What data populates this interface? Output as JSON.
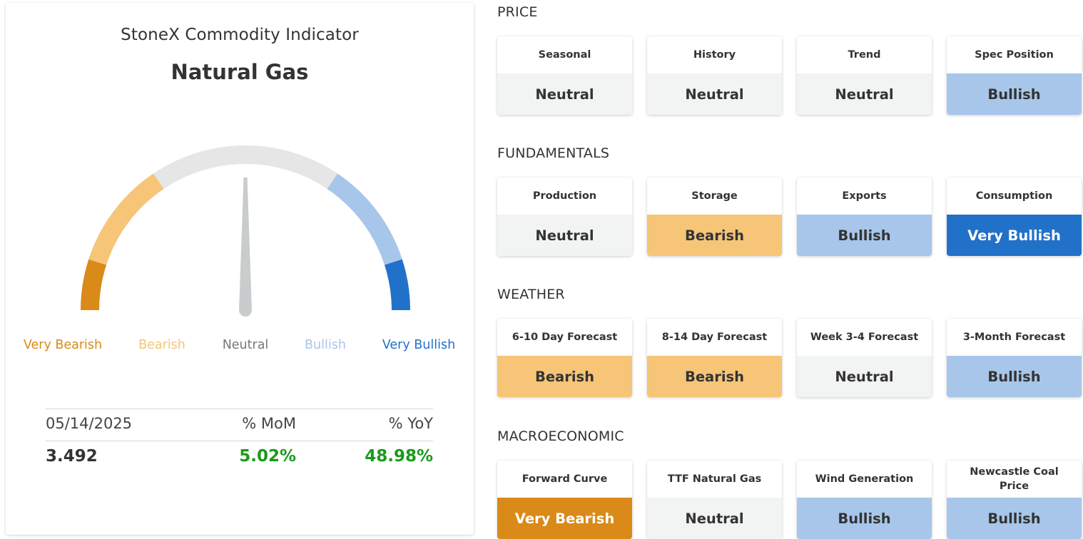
{
  "indicator": {
    "title": "StoneX Commodity Indicator",
    "commodity": "Natural Gas",
    "needle_level": 0.5,
    "legend": [
      {
        "label": "Very Bearish",
        "color": "#d98a18"
      },
      {
        "label": "Bearish",
        "color": "#f6c577"
      },
      {
        "label": "Neutral",
        "color": "#777777"
      },
      {
        "label": "Bullish",
        "color": "#a7c6ea"
      },
      {
        "label": "Very Bullish",
        "color": "#2271c9"
      }
    ],
    "stats": {
      "date": "05/14/2025",
      "mom_label": "% MoM",
      "yoy_label": "% YoY",
      "value": "3.492",
      "mom": "5.02%",
      "yoy": "48.98%"
    }
  },
  "colors": {
    "Neutral": {
      "bg": "#f2f3f3",
      "fg": "#333333"
    },
    "Bearish": {
      "bg": "#f6c577",
      "fg": "#333333"
    },
    "Bullish": {
      "bg": "#a7c6ea",
      "fg": "#333333"
    },
    "Very Bullish": {
      "bg": "#2271c9",
      "fg": "#ffffff"
    },
    "Very Bearish": {
      "bg": "#d98a18",
      "fg": "#ffffff"
    },
    "gauge_track": "#e6e6e6",
    "needle": "#c9cccc",
    "positive": "#1a9a1a"
  },
  "sections": [
    {
      "title": "PRICE",
      "tiles": [
        {
          "label": "Seasonal",
          "status": "Neutral"
        },
        {
          "label": "History",
          "status": "Neutral"
        },
        {
          "label": "Trend",
          "status": "Neutral"
        },
        {
          "label": "Spec Position",
          "status": "Bullish"
        }
      ]
    },
    {
      "title": "FUNDAMENTALS",
      "tiles": [
        {
          "label": "Production",
          "status": "Neutral"
        },
        {
          "label": "Storage",
          "status": "Bearish"
        },
        {
          "label": "Exports",
          "status": "Bullish"
        },
        {
          "label": "Consumption",
          "status": "Very Bullish"
        }
      ]
    },
    {
      "title": "WEATHER",
      "tiles": [
        {
          "label": "6-10 Day Forecast",
          "status": "Bearish"
        },
        {
          "label": "8-14 Day Forecast",
          "status": "Bearish"
        },
        {
          "label": "Week 3-4 Forecast",
          "status": "Neutral"
        },
        {
          "label": "3-Month Forecast",
          "status": "Bullish"
        }
      ]
    },
    {
      "title": "MACROECONOMIC",
      "tiles": [
        {
          "label": "Forward Curve",
          "status": "Very Bearish"
        },
        {
          "label": "TTF Natural Gas",
          "status": "Neutral"
        },
        {
          "label": "Wind Generation",
          "status": "Bullish"
        },
        {
          "label": "Newcastle Coal Price",
          "status": "Bullish"
        }
      ]
    }
  ]
}
